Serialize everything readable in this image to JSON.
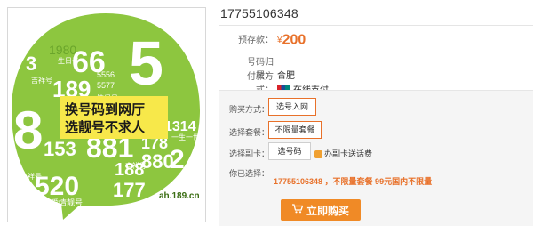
{
  "promo": {
    "headline_1": "换号码到网厅",
    "headline_2": "选靓号不求人",
    "url": "ah.189.cn",
    "numbers": [
      "1980",
      "66",
      "5",
      "3",
      "189",
      "5556",
      "5577",
      "8",
      "2",
      "1314",
      "153",
      "881",
      "178",
      "520",
      "188",
      "880",
      "177",
      "6",
      "3",
      "5"
    ],
    "tags": [
      "生日号",
      "吉祥号",
      "吉祥号",
      "情侣号",
      "吉祥号",
      "爱情靓号",
      "一生一世"
    ]
  },
  "header": {
    "phone_number": "17755106348"
  },
  "details": {
    "price_label": "预存款：",
    "price_currency": "¥",
    "price_value": "200",
    "location_label": "号码归属：",
    "location_value": "合肥",
    "payment_label": "付款方式：",
    "payment_value": "在线支付"
  },
  "options": {
    "buy_method_label": "购买方式：",
    "buy_method_value": "选号入网",
    "plan_label": "选择套餐：",
    "plan_value": "不限量套餐",
    "subcard_label": "选择副卡：",
    "subcard_value": "选号码",
    "subcard_link": "办副卡送话费",
    "selected_label": "你已选择：",
    "selected_summary": "17755106348 ，不限量套餐 99元国内不限量",
    "buy_button": "立即购买"
  },
  "colors": {
    "accent": "#e8712a",
    "button": "#f08a26",
    "promo_green": "#8cc63f"
  }
}
